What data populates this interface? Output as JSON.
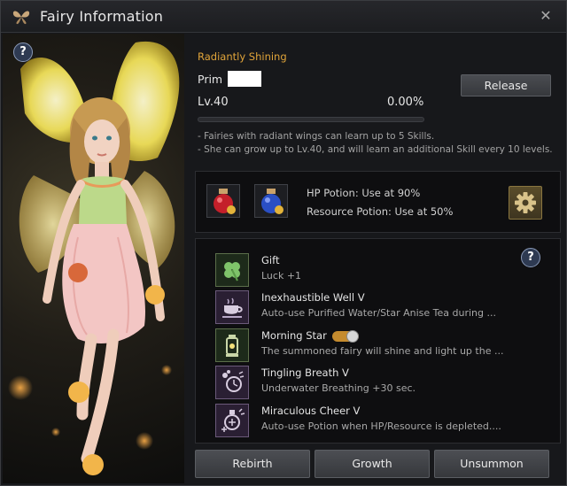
{
  "window": {
    "title": "Fairy Information",
    "icon": "butterfly-icon",
    "close_icon": "close-icon"
  },
  "header": {
    "section_title": "Radiantly Shining",
    "name_label": "Prim",
    "release_label": "Release",
    "level": "Lv.40",
    "exp_percent": "0.00%",
    "exp_fraction": 0
  },
  "notes": [
    "- Fairies with radiant wings can learn up to 5 Skills.",
    "- She can grow up to Lv.40, and will learn an additional Skill every 10 levels."
  ],
  "potions": {
    "hp_slot_icon": "hp-potion-icon",
    "resource_slot_icon": "resource-potion-icon",
    "hp_text": "HP Potion: Use at 90%",
    "resource_text": "Resource Potion: Use at 50%",
    "settings_icon": "gear-icon"
  },
  "skills": [
    {
      "name": "Gift",
      "desc": "Luck +1",
      "icon": "clover-icon"
    },
    {
      "name": "Inexhaustible Well V",
      "desc": "Auto-use Purified Water/Star Anise Tea during ...",
      "icon": "teacup-icon"
    },
    {
      "name": "Morning Star",
      "desc": "The summoned fairy will shine and light up the ...",
      "icon": "lantern-icon",
      "toggle_on": true
    },
    {
      "name": "Tingling Breath V",
      "desc": "Underwater Breathing +30 sec.",
      "icon": "breath-timer-icon"
    },
    {
      "name": "Miraculous Cheer V",
      "desc": "Auto-use Potion when HP/Resource is depleted....",
      "icon": "potion-cheer-icon"
    }
  ],
  "footer": {
    "rebirth_label": "Rebirth",
    "growth_label": "Growth",
    "unsummon_label": "Unsummon"
  },
  "colors": {
    "accent_gold": "#e0a43a",
    "toggle_on": "#c58b2e",
    "panel_bg": "#17181b"
  }
}
